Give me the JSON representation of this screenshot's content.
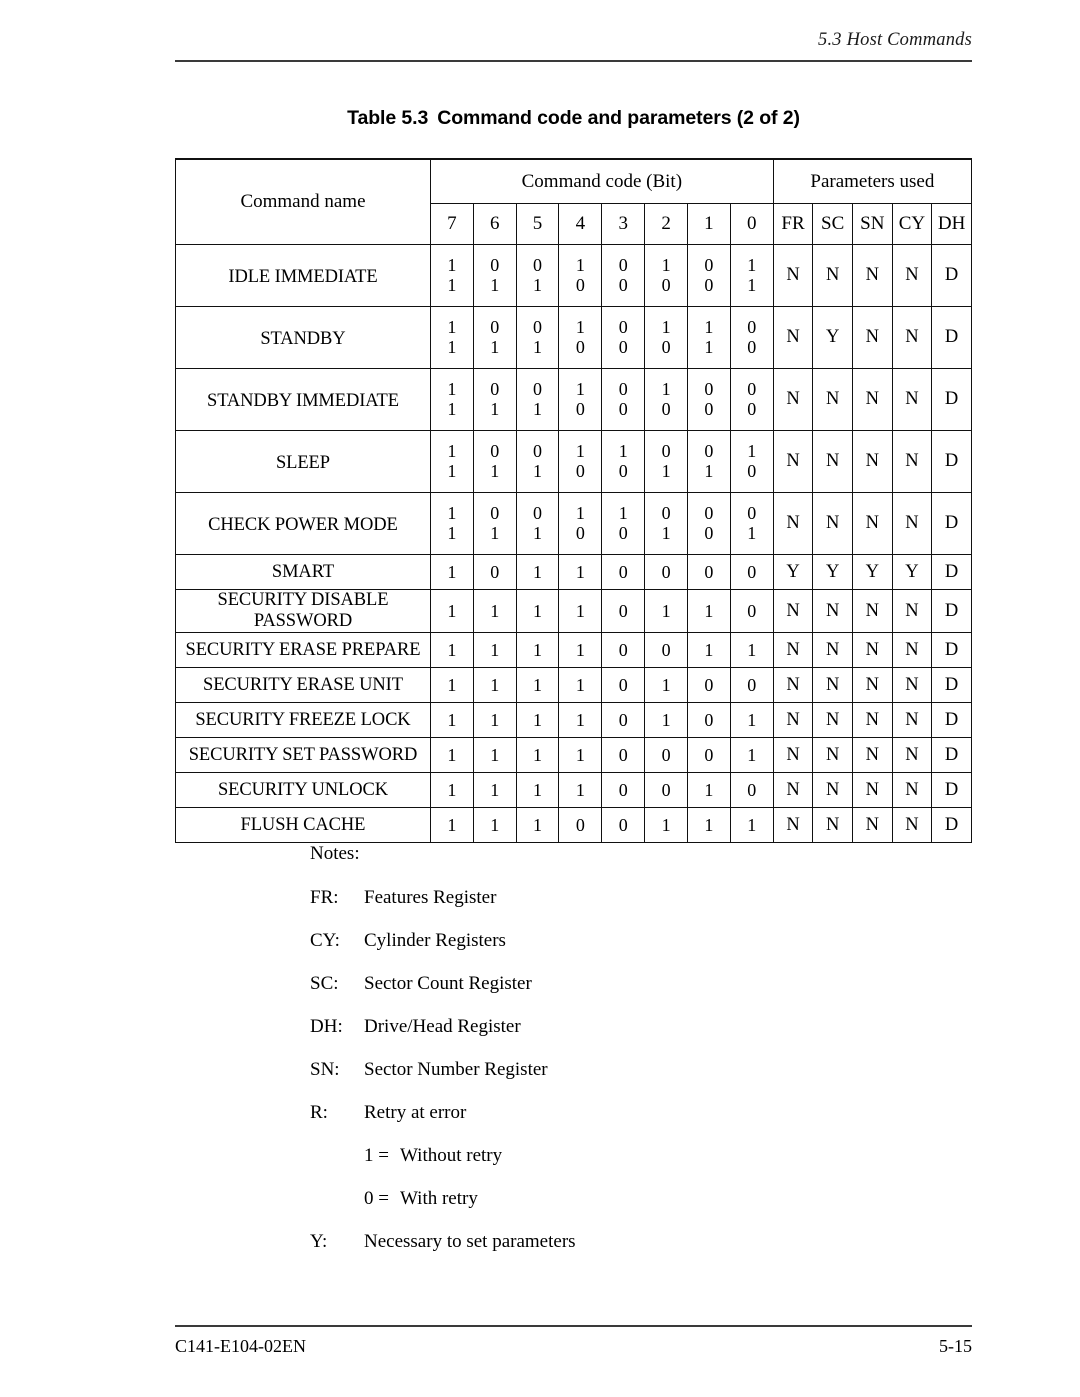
{
  "header": {
    "running_head": "5.3  Host Commands"
  },
  "caption": {
    "label": "Table 5.3",
    "text": "Command code and parameters (2 of 2)"
  },
  "table": {
    "col_name_header": "Command name",
    "group_headers": {
      "command_code": "Command code (Bit)",
      "parameters_used": "Parameters used"
    },
    "bit_headers": [
      "7",
      "6",
      "5",
      "4",
      "3",
      "2",
      "1",
      "0"
    ],
    "param_headers": [
      "FR",
      "SC",
      "SN",
      "CY",
      "DH"
    ],
    "rows": [
      {
        "name": "IDLE IMMEDIATE",
        "double": true,
        "bits_row1": [
          "1",
          "0",
          "0",
          "1",
          "0",
          "1",
          "0",
          "1"
        ],
        "bits_row2": [
          "1",
          "1",
          "1",
          "0",
          "0",
          "0",
          "0",
          "1"
        ],
        "params": [
          "N",
          "N",
          "N",
          "N",
          "D"
        ]
      },
      {
        "name": "STANDBY",
        "double": true,
        "bits_row1": [
          "1",
          "0",
          "0",
          "1",
          "0",
          "1",
          "1",
          "0"
        ],
        "bits_row2": [
          "1",
          "1",
          "1",
          "0",
          "0",
          "0",
          "1",
          "0"
        ],
        "params": [
          "N",
          "Y",
          "N",
          "N",
          "D"
        ]
      },
      {
        "name": "STANDBY IMMEDIATE",
        "double": true,
        "bits_row1": [
          "1",
          "0",
          "0",
          "1",
          "0",
          "1",
          "0",
          "0"
        ],
        "bits_row2": [
          "1",
          "1",
          "1",
          "0",
          "0",
          "0",
          "0",
          "0"
        ],
        "params": [
          "N",
          "N",
          "N",
          "N",
          "D"
        ]
      },
      {
        "name": "SLEEP",
        "double": true,
        "bits_row1": [
          "1",
          "0",
          "0",
          "1",
          "1",
          "0",
          "0",
          "1"
        ],
        "bits_row2": [
          "1",
          "1",
          "1",
          "0",
          "0",
          "1",
          "1",
          "0"
        ],
        "params": [
          "N",
          "N",
          "N",
          "N",
          "D"
        ]
      },
      {
        "name": "CHECK POWER MODE",
        "double": true,
        "bits_row1": [
          "1",
          "0",
          "0",
          "1",
          "1",
          "0",
          "0",
          "0"
        ],
        "bits_row2": [
          "1",
          "1",
          "1",
          "0",
          "0",
          "1",
          "0",
          "1"
        ],
        "params": [
          "N",
          "N",
          "N",
          "N",
          "D"
        ]
      },
      {
        "name": "SMART",
        "double": false,
        "bits_row1": [
          "1",
          "0",
          "1",
          "1",
          "0",
          "0",
          "0",
          "0"
        ],
        "params": [
          "Y",
          "Y",
          "Y",
          "Y",
          "D"
        ]
      },
      {
        "name": "SECURITY DISABLE PASSWORD",
        "double": false,
        "bits_row1": [
          "1",
          "1",
          "1",
          "1",
          "0",
          "1",
          "1",
          "0"
        ],
        "params": [
          "N",
          "N",
          "N",
          "N",
          "D"
        ]
      },
      {
        "name": "SECURITY ERASE PREPARE",
        "double": false,
        "bits_row1": [
          "1",
          "1",
          "1",
          "1",
          "0",
          "0",
          "1",
          "1"
        ],
        "params": [
          "N",
          "N",
          "N",
          "N",
          "D"
        ]
      },
      {
        "name": "SECURITY ERASE UNIT",
        "double": false,
        "bits_row1": [
          "1",
          "1",
          "1",
          "1",
          "0",
          "1",
          "0",
          "0"
        ],
        "params": [
          "N",
          "N",
          "N",
          "N",
          "D"
        ]
      },
      {
        "name": "SECURITY FREEZE LOCK",
        "double": false,
        "bits_row1": [
          "1",
          "1",
          "1",
          "1",
          "0",
          "1",
          "0",
          "1"
        ],
        "params": [
          "N",
          "N",
          "N",
          "N",
          "D"
        ]
      },
      {
        "name": "SECURITY SET PASSWORD",
        "double": false,
        "bits_row1": [
          "1",
          "1",
          "1",
          "1",
          "0",
          "0",
          "0",
          "1"
        ],
        "params": [
          "N",
          "N",
          "N",
          "N",
          "D"
        ]
      },
      {
        "name": "SECURITY UNLOCK",
        "double": false,
        "bits_row1": [
          "1",
          "1",
          "1",
          "1",
          "0",
          "0",
          "1",
          "0"
        ],
        "params": [
          "N",
          "N",
          "N",
          "N",
          "D"
        ]
      },
      {
        "name": "FLUSH CACHE",
        "double": false,
        "bits_row1": [
          "1",
          "1",
          "1",
          "0",
          "0",
          "1",
          "1",
          "1"
        ],
        "params": [
          "N",
          "N",
          "N",
          "N",
          "D"
        ]
      }
    ]
  },
  "notes": {
    "title": "Notes:",
    "entries": [
      {
        "key": "FR:",
        "value": "Features Register",
        "indented": false
      },
      {
        "key": "CY:",
        "value": "Cylinder Registers",
        "indented": false
      },
      {
        "key": "SC:",
        "value": "Sector Count Register",
        "indented": false
      },
      {
        "key": "DH:",
        "value": "Drive/Head Register",
        "indented": false
      },
      {
        "key": "SN:",
        "value": "Sector Number Register",
        "indented": false
      },
      {
        "key": "R:",
        "value": "Retry at error",
        "indented": false
      },
      {
        "key": "1 =",
        "value": "Without retry",
        "indented": true
      },
      {
        "key": "0 =",
        "value": "With retry",
        "indented": true
      },
      {
        "key": "Y:",
        "value": "Necessary to set parameters",
        "indented": false
      }
    ]
  },
  "footer": {
    "doc_number": "C141-E104-02EN",
    "page_number": "5-15"
  }
}
